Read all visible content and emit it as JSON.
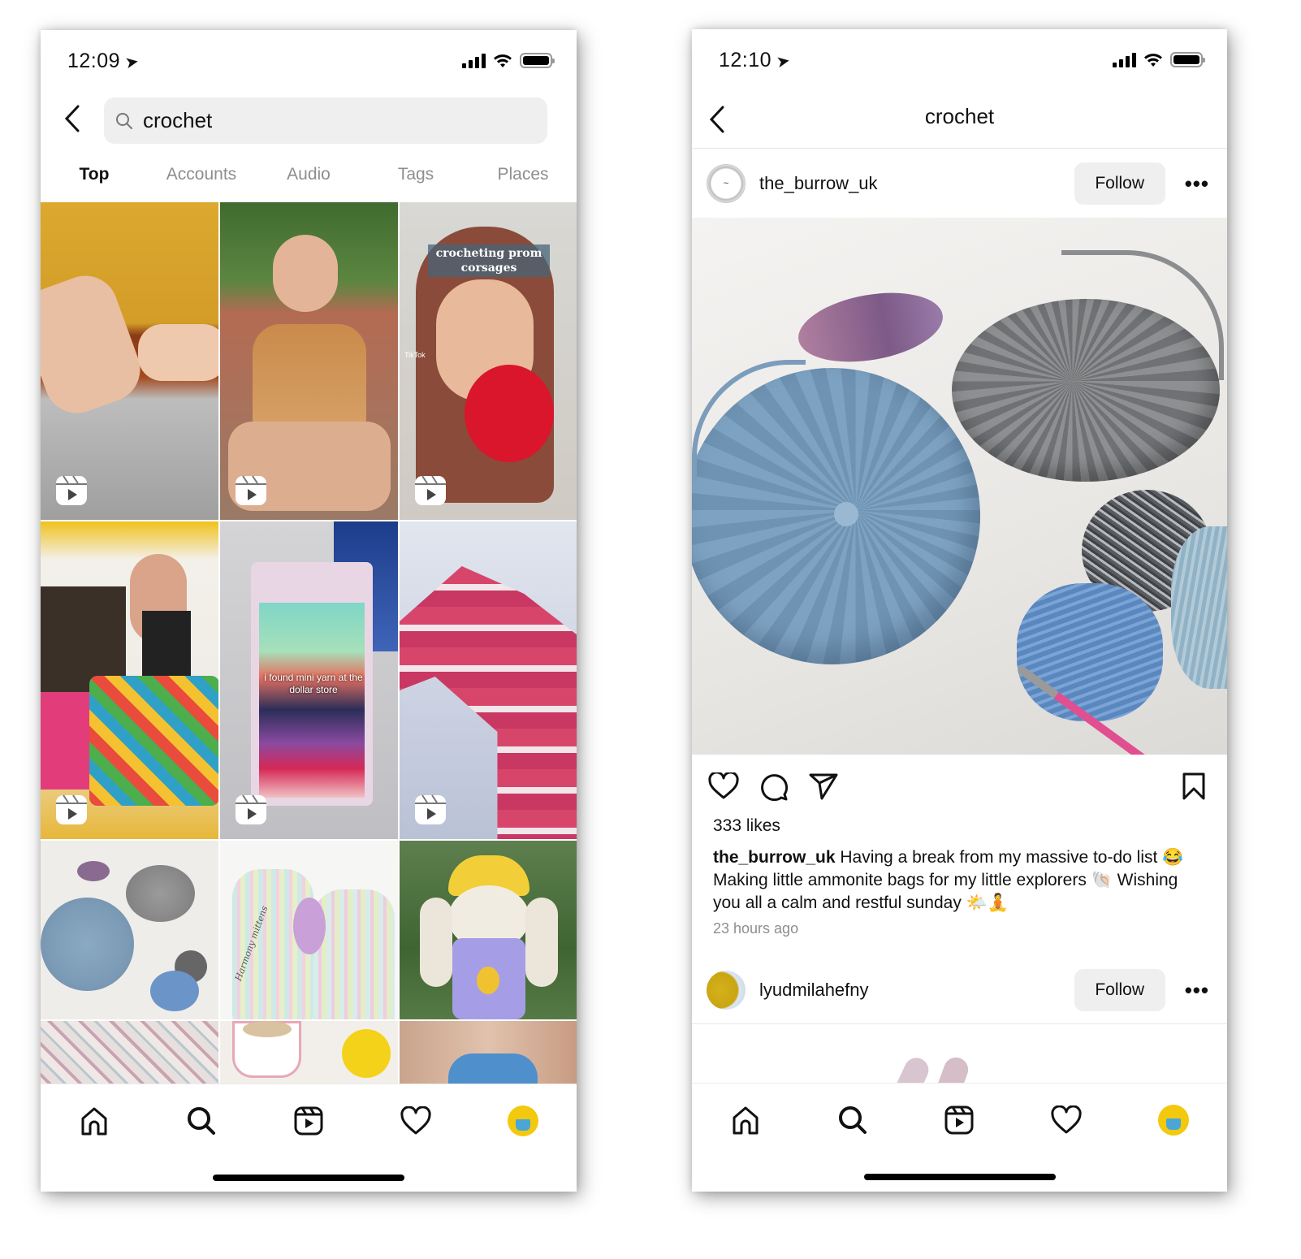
{
  "left_screen": {
    "status": {
      "time": "12:09",
      "location_icon": "location-arrow-icon"
    },
    "search": {
      "query": "crochet",
      "icon": "search-icon"
    },
    "tabs": [
      {
        "label": "Top",
        "active": true
      },
      {
        "label": "Accounts",
        "active": false
      },
      {
        "label": "Audio",
        "active": false
      },
      {
        "label": "Tags",
        "active": false
      },
      {
        "label": "Places",
        "active": false
      }
    ],
    "grid": [
      {
        "subject": "hands crocheting yellow and rust yarn",
        "reel": true
      },
      {
        "subject": "woman wearing crochet granny square top",
        "reel": true
      },
      {
        "subject": "girl holding red yarn",
        "reel": true,
        "caption": "crocheting prom corsages",
        "watermark": "TikTok"
      },
      {
        "subject": "woman holding granny square bag",
        "reel": true
      },
      {
        "subject": "mini yarn pack at dollar store",
        "reel": true,
        "caption": "i found mini yarn at the dollar store"
      },
      {
        "subject": "pink striped crochet sweater",
        "reel": true
      },
      {
        "subject": "ammonite crochet bags",
        "reel": false
      },
      {
        "subject": "colorful fingerless mittens",
        "reel": false,
        "caption": "Harmony mittens"
      },
      {
        "subject": "crochet bunny in overalls",
        "reel": false
      },
      {
        "subject": "floral crochet blanket",
        "reel": false
      },
      {
        "subject": "bee mug and sunflower",
        "reel": false
      },
      {
        "subject": "blue knit top",
        "reel": false
      }
    ]
  },
  "right_screen": {
    "status": {
      "time": "12:10",
      "location_icon": "location-arrow-icon"
    },
    "title": "crochet",
    "post": {
      "username": "the_burrow_uk",
      "follow_label": "Follow",
      "more_label": "•••",
      "image_subject": "crocheted ammonite bags with yarn balls and crochet hook",
      "likes": "333 likes",
      "caption_user": "the_burrow_uk",
      "caption_text": " Having a break from my massive to-do list 😂 Making little ammonite bags for my little explorers 🐚 Wishing you all a calm and restful sunday 🌤️🧘",
      "time_ago": "23 hours ago"
    },
    "next_post": {
      "username": "lyudmilahefny",
      "follow_label": "Follow",
      "more_label": "•••"
    }
  },
  "bottom_nav": [
    "home",
    "search",
    "reels",
    "activity",
    "profile"
  ],
  "colors": {
    "accent_profile": "#f3c90e",
    "follow_bg": "#efefef",
    "muted_text": "#8e8e8e"
  }
}
